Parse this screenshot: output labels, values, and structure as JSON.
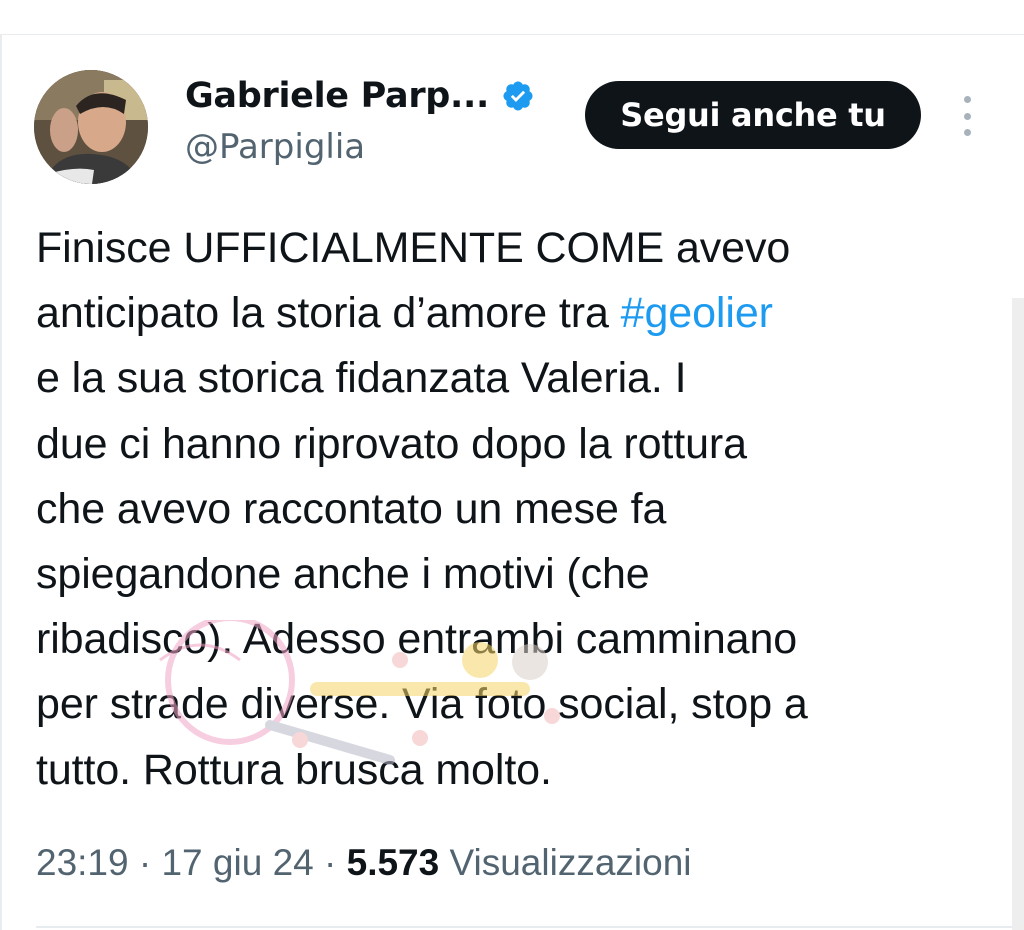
{
  "author": {
    "display_name": "Gabriele Parp...",
    "handle": "@Parpiglia",
    "verified_icon": "verified-badge-icon",
    "avatar": "avatar-photo"
  },
  "actions": {
    "follow_label": "Segui anche tu",
    "more_icon": "more-vertical-icon"
  },
  "tweet": {
    "lines": [
      "Finisce UFFICIALMENTE COME avevo",
      "anticipato la storia d’amore tra ",
      "e la sua storica fidanzata Valeria. I",
      "due ci hanno riprovato dopo la rottura",
      "che avevo raccontato un mese fa",
      "spiegandone anche i motivi (che",
      "ribadisco). Adesso entrambi camminano",
      "per strade diverse. Via foto social, stop a",
      "tutto. Rottura brusca molto."
    ],
    "hashtag": "#geolier"
  },
  "meta": {
    "time": "23:19",
    "separator": "·",
    "date": "17 giu 24",
    "views_count": "5.573",
    "views_label": "Visualizzazioni"
  },
  "colors": {
    "text": "#0f1419",
    "secondary": "#536471",
    "accent": "#1d9bf0",
    "button_bg": "#0f1419"
  }
}
